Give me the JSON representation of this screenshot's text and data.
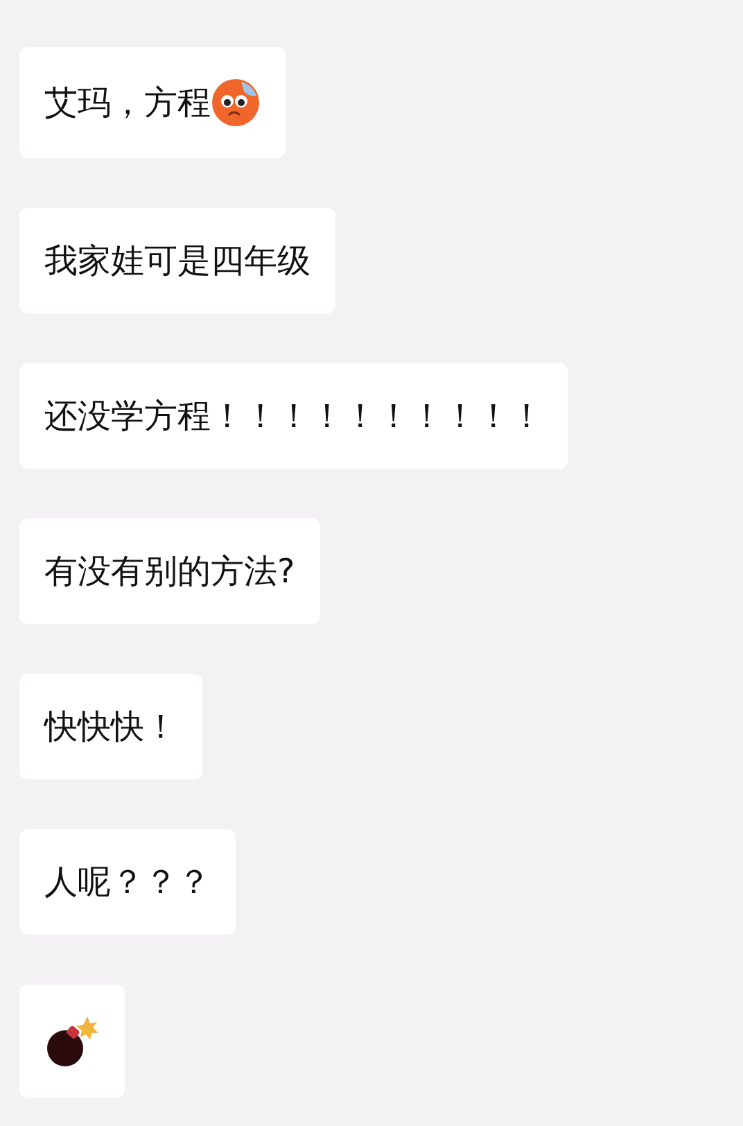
{
  "messages": [
    {
      "parts": [
        {
          "kind": "text",
          "text": "艾玛，方程"
        },
        {
          "kind": "sweat-emoji"
        }
      ]
    },
    {
      "parts": [
        {
          "kind": "text",
          "text": "我家娃可是四年级"
        }
      ]
    },
    {
      "parts": [
        {
          "kind": "text",
          "text": "还没学方程！！！！！！！！！！"
        }
      ]
    },
    {
      "parts": [
        {
          "kind": "text",
          "text": "有没有别的方法?"
        }
      ]
    },
    {
      "parts": [
        {
          "kind": "text",
          "text": "快快快！"
        }
      ]
    },
    {
      "parts": [
        {
          "kind": "text",
          "text": "人呢？？？"
        }
      ]
    },
    {
      "parts": [
        {
          "kind": "bomb-emoji"
        }
      ]
    }
  ]
}
